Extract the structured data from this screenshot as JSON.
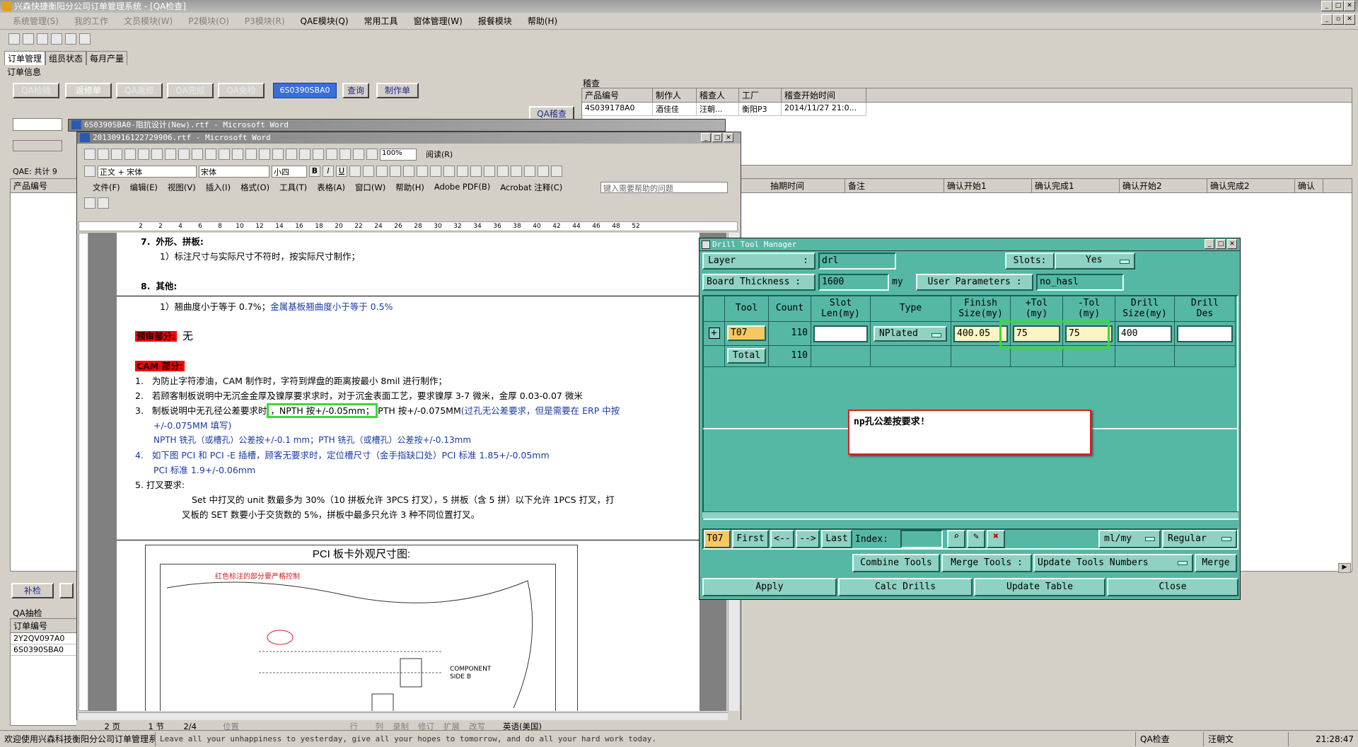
{
  "app": {
    "title": "兴森快捷衡阳分公司订单管理系统 - [QA检查]",
    "menu": [
      "系统管理(S)",
      "我的工作",
      "文员模块(W)",
      "P2模块(O)",
      "P3模块(R)",
      "QAE模块(Q)",
      "常用工具",
      "窗体管理(W)",
      "报餐模块",
      "帮助(H)"
    ]
  },
  "tabs": [
    "订单管理",
    "组员状态",
    "每月产量"
  ],
  "order_info": {
    "group_label": "订单信息",
    "buttons": [
      "QA检验",
      "返修单",
      "QA返修",
      "QA完成",
      "QA免检"
    ],
    "search_value": "6S0390SBA0",
    "query_label": "查询",
    "make_label": "制作单",
    "qa_review_label": "QA稽查",
    "qae_total": "QAE: 共计 9",
    "left_col": "产品编号"
  },
  "audit": {
    "label": "稽查",
    "headers": [
      "产品编号",
      "制作人",
      "稽查人",
      "工厂",
      "稽查开始时间"
    ],
    "row": [
      "4S039178A0",
      "酒佳佳",
      "汪朝...",
      "衡阳P3",
      "2014/11/27 21:0..."
    ]
  },
  "main_grid": {
    "headers": [
      "抽期时间",
      "备注",
      "确认开始1",
      "确认完成1",
      "确认开始2",
      "确认完成2",
      "确认"
    ]
  },
  "bottom_left": {
    "btn": "补检",
    "qa_label": "QA抽检",
    "col": "订单编号",
    "rows": [
      "2Y2QV097A0",
      "6S0390SBA0"
    ]
  },
  "word_back": {
    "title": "6S0390SBA0-阻抗设计(New).rtf - Microsoft Word"
  },
  "word": {
    "title": "20130916122729906.rtf - Microsoft Word",
    "style_box": "正文 + 宋体",
    "font_box": "宋体",
    "size_box": "小四",
    "zoom": "100%",
    "read_btn": "阅读(R)",
    "menu": [
      "文件(F)",
      "编辑(E)",
      "视图(V)",
      "插入(I)",
      "格式(O)",
      "工具(T)",
      "表格(A)",
      "窗口(W)",
      "帮助(H)",
      "Adobe PDF(B)",
      "Acrobat 注释(C)"
    ],
    "help_placeholder": "键入需要帮助的问题",
    "ruler": [
      "2",
      "2",
      "4",
      "6",
      "8",
      "10",
      "12",
      "14",
      "16",
      "18",
      "20",
      "22",
      "24",
      "26",
      "28",
      "30",
      "32",
      "34",
      "36",
      "38",
      "40",
      "42",
      "44",
      "46",
      "48",
      "52"
    ],
    "lines": {
      "s7": "7.",
      "s7_title": "外形、拼板:",
      "s7_1": "1）标注尺寸与实际尺寸不符时，按实际尺寸制作；",
      "s8": "8.",
      "s8_title": "其他:",
      "s8_1a": "1）翘曲度小于等于 0.7%；",
      "s8_1b": "金属基板翘曲度小于等于 0.5%",
      "pre_label": "预审部分:",
      "pre_value": "无",
      "cam_label": "CAM 部分:",
      "c1": "为防止字符渗油，CAM 制作时，字符到焊盘的距离按最小 8mil 进行制作；",
      "c2": "若顾客制板说明中无沉金金厚及镍厚要求求时，对于沉金表面工艺，要求镍厚 3-7 微米，金厚 0.03-0.07 微米",
      "c3a": "制板说明中无孔径公差要求时",
      "c3b": "，NPTH 按+/-0.05mm；",
      "c3c": "PTH 按+/-0.075MM",
      "c3d": "(过孔无公差要求，但是需要在 ERP 中按",
      "c3e": "+/-0.075MM 填写)",
      "c3f": "NPTH 铣孔（或槽孔）公差按+/-0.1 mm；PTH 铣孔（或槽孔）公差按+/-0.13mm",
      "c4a": "如下图 PCI 和 PCI -E 插槽，顾客无要求时，定位槽尺寸（金手指缺口处）PCI 标准 1.85+/-0.05mm",
      "c4b": "PCI 标准 1.9+/-0.06mm",
      "c5": "打叉要求:",
      "c5a": "Set 中打叉的 unit 数最多为 30%（10 拼板允许 3PCS 打叉），5 拼板（含 5 拼）以下允许 1PCS 打叉，打",
      "c5b": "叉板的 SET 数要小于交货数的 5%，拼板中最多只允许 3 种不同位置打叉。",
      "pci_title": "PCI 板卡外观尺寸图:",
      "pci_note": "红色标注的部分要严格控制",
      "pci_side": "COMPONENT SIDE B"
    },
    "nums": [
      "1.",
      "2.",
      "3.",
      "4.",
      "5."
    ],
    "status": [
      "2 页",
      "1 节",
      "2/4",
      "位置",
      "行",
      "列",
      "录制",
      "修订",
      "扩展",
      "改写",
      "英语(美国)"
    ]
  },
  "drill": {
    "title": "Drill Tool Manager",
    "layer_label": "Layer",
    "layer_value": "drl",
    "slots_label": "Slots:",
    "slots_value": "Yes",
    "board_label": "Board Thickness :",
    "board_value": "1600",
    "board_unit": "my",
    "user_label": "User Parameters :",
    "user_value": "no_hasl",
    "headers": [
      "Tool",
      "Count",
      "Slot Len(my)",
      "Type",
      "Finish Size(my)",
      "+Tol (my)",
      "-Tol (my)",
      "Drill Size(my)",
      "Drill Des"
    ],
    "row": {
      "tool": "T07",
      "count": "110",
      "type": "NPlated",
      "finish": "400.05",
      "ptol": "75",
      "ntol": "75",
      "drill": "400"
    },
    "total": {
      "label": "Total",
      "count": "110"
    },
    "note": "np孔公差按要求!",
    "nav": {
      "current": "T07",
      "first": "First",
      "prev": "<--",
      "next": "-->",
      "last": "Last",
      "index_label": "Index:",
      "unit": "ml/my",
      "mode": "Regular"
    },
    "buttons": [
      "Combine Tools",
      "Merge Tools :",
      "Update Tools Numbers",
      "Merge"
    ],
    "actions": [
      "Apply",
      "Calc Drills",
      "Update Table",
      "Close"
    ]
  },
  "status": {
    "welcome": "欢迎使用兴森科技衡阳分公司订单管理系统.",
    "motto": "Leave all your unhappiness to yesterday, give all your hopes to tomorrow, and do all your hard work today.",
    "module": "QA检查",
    "user": "汪朝文",
    "time": "21:28:47"
  }
}
